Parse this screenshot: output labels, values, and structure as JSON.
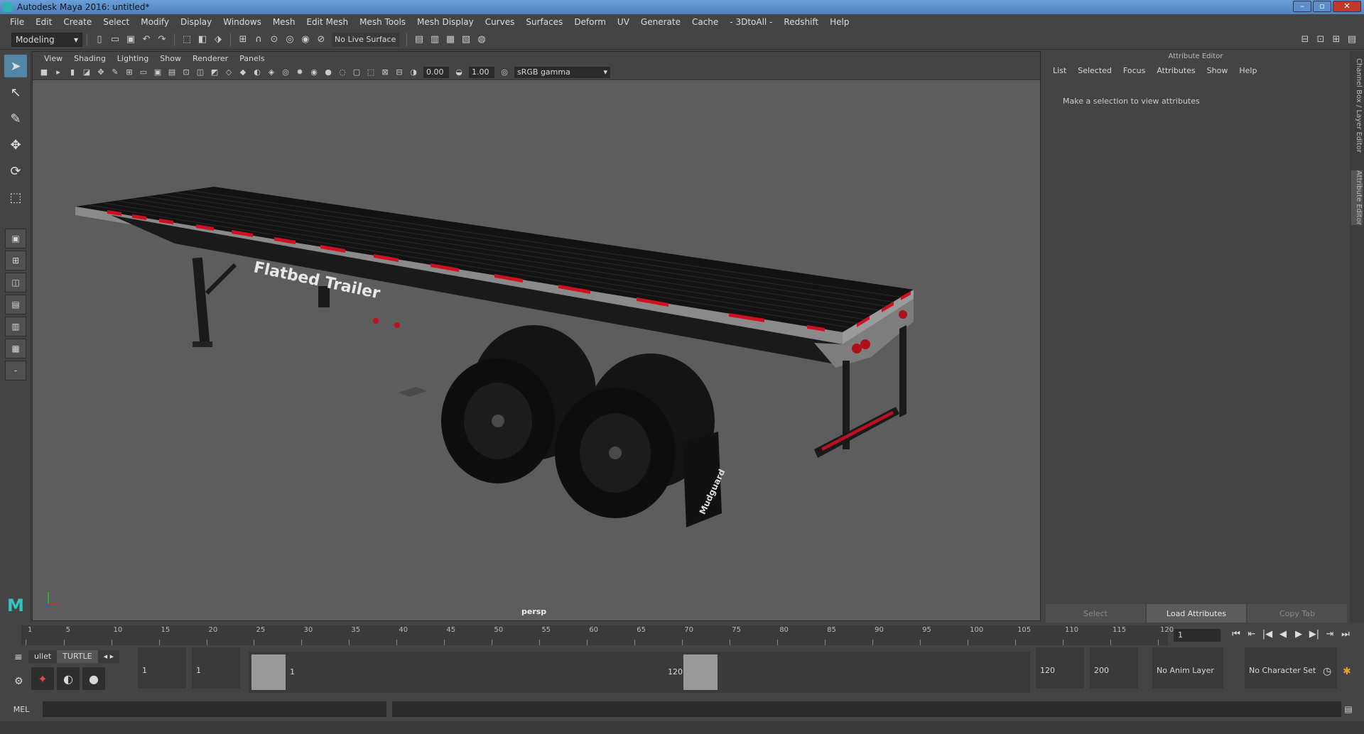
{
  "window": {
    "title": "Autodesk Maya 2016: untitled*"
  },
  "menus": [
    "File",
    "Edit",
    "Create",
    "Select",
    "Modify",
    "Display",
    "Windows",
    "Mesh",
    "Edit Mesh",
    "Mesh Tools",
    "Mesh Display",
    "Curves",
    "Surfaces",
    "Deform",
    "UV",
    "Generate",
    "Cache",
    "- 3DtoAll -",
    "Redshift",
    "Help"
  ],
  "shelf": {
    "mode": "Modeling",
    "live_surface": "No Live Surface"
  },
  "viewport": {
    "menus": [
      "View",
      "Shading",
      "Lighting",
      "Show",
      "Renderer",
      "Panels"
    ],
    "exposure": "0.00",
    "gamma": "1.00",
    "colorspace": "sRGB gamma",
    "camera": "persp",
    "trailer_text": "Flatbed Trailer",
    "mudflap_text": "Mudguard"
  },
  "attribute_editor": {
    "title": "Attribute Editor",
    "menus": [
      "List",
      "Selected",
      "Focus",
      "Attributes",
      "Show",
      "Help"
    ],
    "message": "Make a selection to view attributes",
    "buttons": [
      "Select",
      "Load Attributes",
      "Copy Tab"
    ]
  },
  "side_tabs": [
    "Channel Box / Layer Editor",
    "Attribute Editor"
  ],
  "timeline": {
    "ticks": [
      "1",
      "5",
      "10",
      "15",
      "20",
      "25",
      "30",
      "35",
      "40",
      "45",
      "50",
      "55",
      "60",
      "65",
      "70",
      "75",
      "80",
      "85",
      "90",
      "95",
      "100",
      "105",
      "110",
      "115",
      "120"
    ],
    "current_frame": "1",
    "play_icons": [
      "⏮",
      "⏴⏴",
      "|◀",
      "◀",
      "▶",
      "▶|",
      "⏭"
    ]
  },
  "shelf_tabs": [
    "ullet",
    "TURTLE"
  ],
  "range": {
    "start_field": "1",
    "playback_start": "1",
    "slider_start": "1",
    "slider_end": "120",
    "playback_end": "120",
    "end_field": "200",
    "anim_layer": "No Anim Layer",
    "char_set": "No Character Set"
  },
  "command": {
    "label": "MEL"
  }
}
